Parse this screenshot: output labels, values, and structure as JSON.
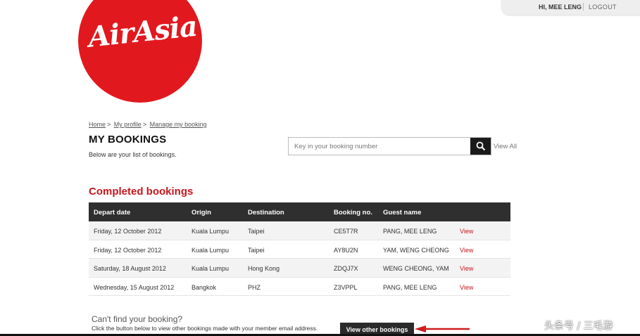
{
  "user": {
    "greeting": "HI, MEE LENG",
    "logout": "LOGOUT"
  },
  "brand": {
    "name": "AirAsia",
    "color": "#e1191e"
  },
  "breadcrumb": [
    {
      "label": "Home",
      "sep": ">"
    },
    {
      "label": "My profile",
      "sep": ">"
    },
    {
      "label": "Manage my booking",
      "sep": ""
    }
  ],
  "page": {
    "title": "MY BOOKINGS",
    "subtitle": "Below are your list of bookings."
  },
  "search": {
    "placeholder": "Key in your booking number",
    "icon": "search-icon",
    "view_all": "View All"
  },
  "completed": {
    "title": "Completed bookings",
    "columns": [
      "Depart date",
      "Origin",
      "Destination",
      "Booking no.",
      "Guest name",
      ""
    ],
    "rows": [
      {
        "date": "Friday, 12 October 2012",
        "origin": "Kuala Lumpu",
        "destination": "Taipei",
        "booking": "CE5T7R",
        "guest": "PANG, MEE LENG",
        "action": "View"
      },
      {
        "date": "Friday, 12 October 2012",
        "origin": "Kuala Lumpu",
        "destination": "Taipei",
        "booking": "AY8U2N",
        "guest": "YAM, WENG CHEONG",
        "action": "View"
      },
      {
        "date": "Saturday, 18 August 2012",
        "origin": "Kuala Lumpu",
        "destination": "Hong Kong",
        "booking": "ZDQJ7X",
        "guest": "WENG CHEONG, YAM",
        "action": "View"
      },
      {
        "date": "Wednesday, 15 August 2012",
        "origin": "Bangkok",
        "destination": "PHZ",
        "booking": "Z3VPPL",
        "guest": "PANG, MEE LENG",
        "action": "View"
      }
    ]
  },
  "help": {
    "title": "Can't find your booking?",
    "text": "Click the button below to view other bookings made with your member email address.",
    "button": "View other bookings"
  },
  "watermark": "头条号 / 三毛游",
  "colors": {
    "accent": "#c8161d",
    "header_bg": "#2f2f2f"
  }
}
